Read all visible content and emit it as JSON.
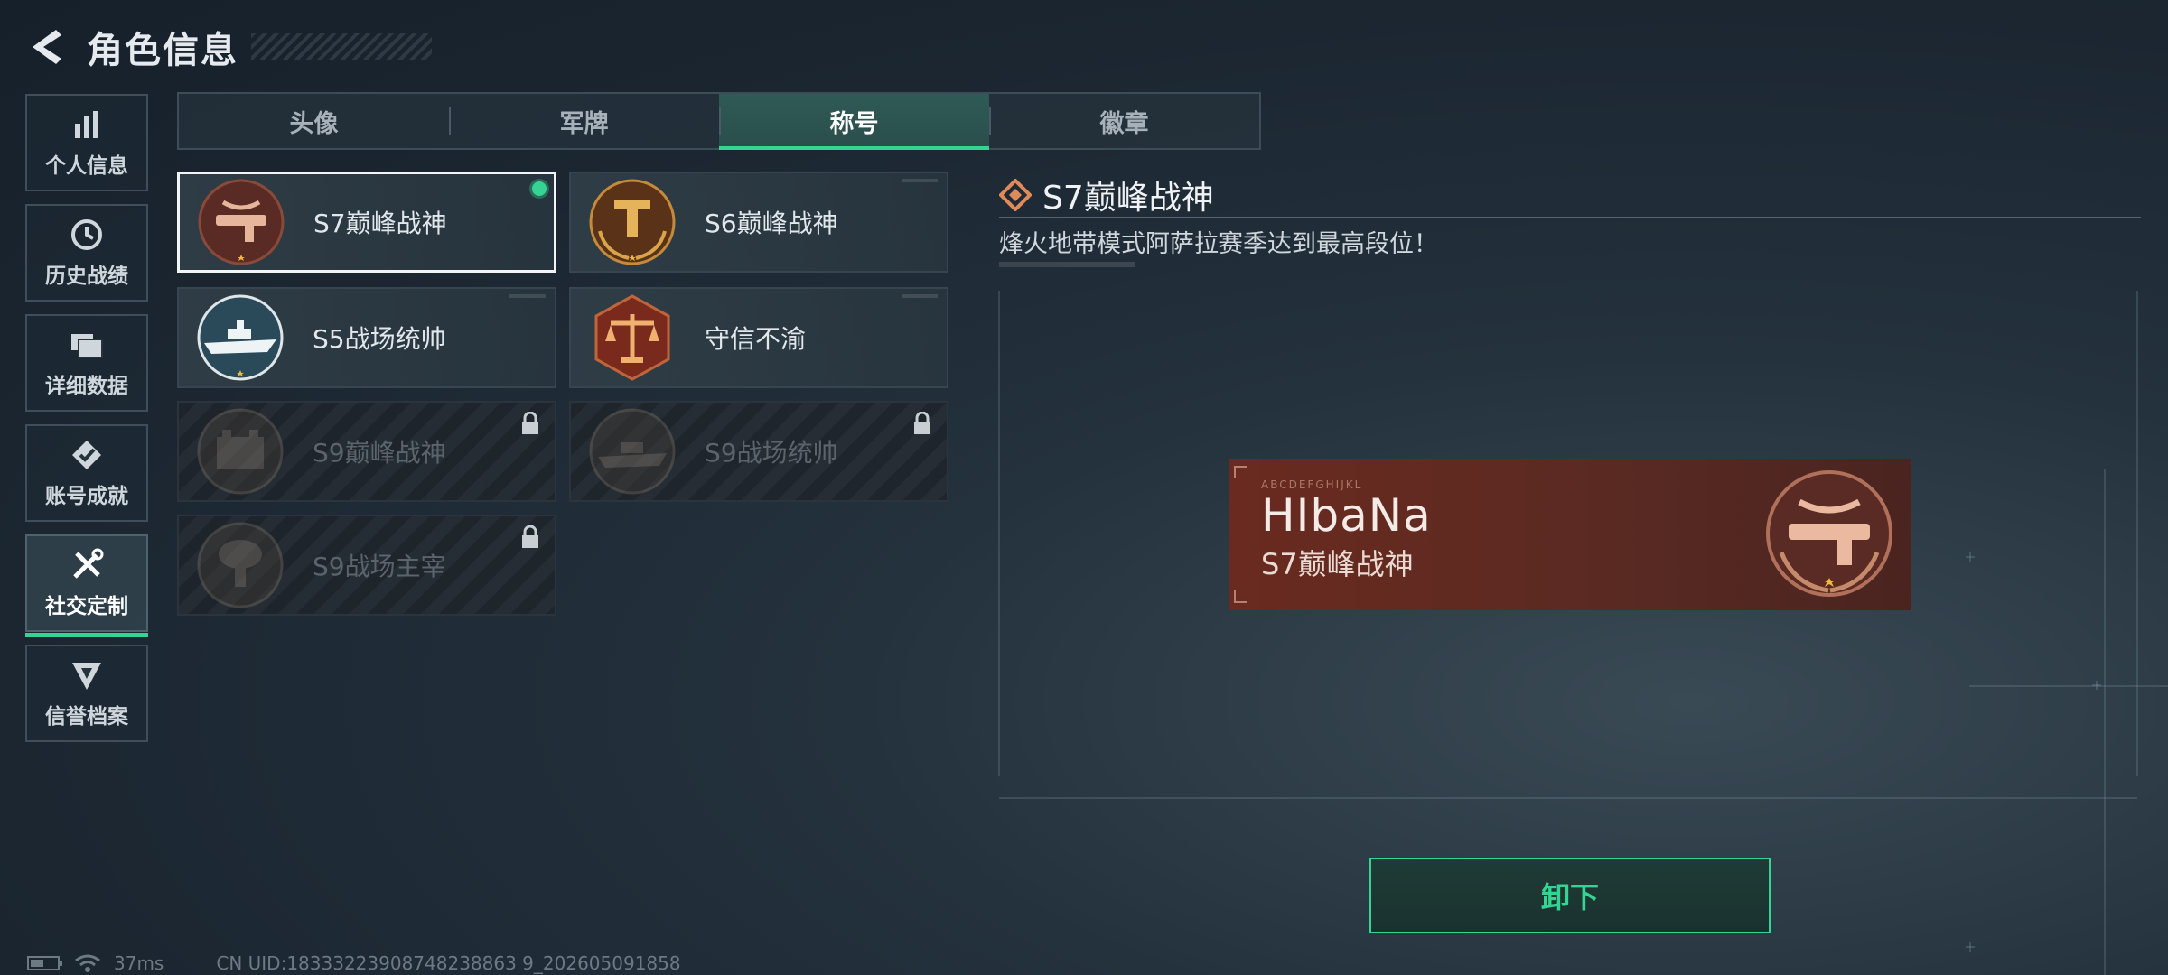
{
  "header": {
    "title": "角色信息"
  },
  "sidebar": {
    "items": [
      {
        "label": "个人信息",
        "icon": "bar-chart-icon",
        "active": false
      },
      {
        "label": "历史战绩",
        "icon": "clock-icon",
        "active": false
      },
      {
        "label": "详细数据",
        "icon": "folder-icon",
        "active": false
      },
      {
        "label": "账号成就",
        "icon": "badge-icon",
        "active": false
      },
      {
        "label": "社交定制",
        "icon": "tools-icon",
        "active": true
      },
      {
        "label": "信誉档案",
        "icon": "shield-icon",
        "active": false
      }
    ]
  },
  "tabs": [
    {
      "label": "头像",
      "active": false
    },
    {
      "label": "军牌",
      "active": false
    },
    {
      "label": "称号",
      "active": true
    },
    {
      "label": "徽章",
      "active": false
    }
  ],
  "titles": [
    {
      "label": "S7巅峰战神",
      "locked": false,
      "selected": true,
      "equipped": true
    },
    {
      "label": "S6巅峰战神",
      "locked": false,
      "selected": false,
      "equipped": false
    },
    {
      "label": "S5战场统帅",
      "locked": false,
      "selected": false,
      "equipped": false
    },
    {
      "label": "守信不渝",
      "locked": false,
      "selected": false,
      "equipped": false
    },
    {
      "label": "S9巅峰战神",
      "locked": true,
      "selected": false,
      "equipped": false
    },
    {
      "label": "S9战场统帅",
      "locked": true,
      "selected": false,
      "equipped": false
    },
    {
      "label": "S9战场主宰",
      "locked": true,
      "selected": false,
      "equipped": false
    }
  ],
  "detail": {
    "title": "S7巅峰战神",
    "description": "烽火地带模式阿萨拉赛季达到最高段位！"
  },
  "plate": {
    "code": "ABCDEFGHIJKL",
    "player_name": "HIbaNa",
    "title": "S7巅峰战神"
  },
  "actions": {
    "unequip_label": "卸下"
  },
  "status": {
    "ping": "37ms",
    "uid": "CN UID:18333223908748238863 9_202605091858"
  },
  "colors": {
    "accent": "#35d493",
    "plate": "#6a2a1f"
  }
}
